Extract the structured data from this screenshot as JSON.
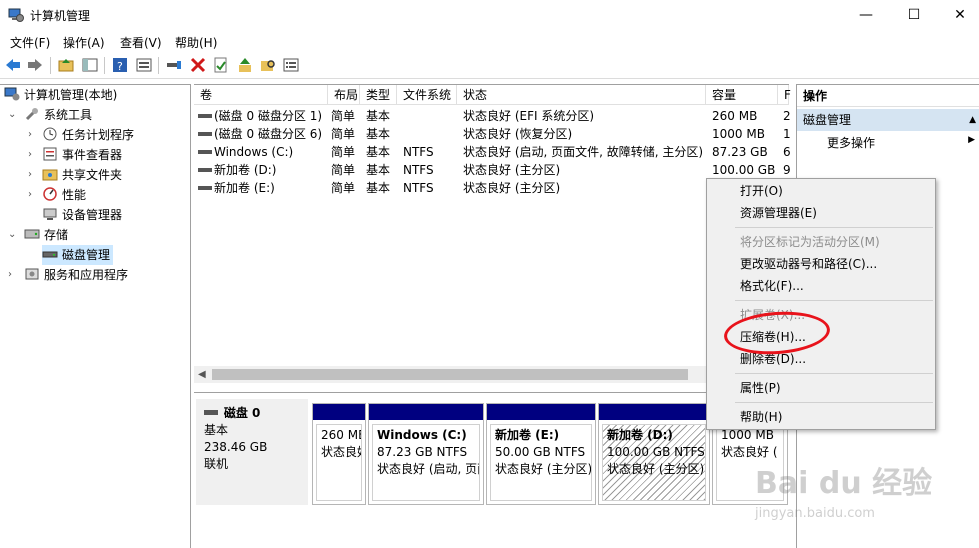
{
  "window": {
    "title": "计算机管理"
  },
  "menu": [
    "文件(F)",
    "操作(A)",
    "查看(V)",
    "帮助(H)"
  ],
  "tree": {
    "root": "计算机管理(本地)",
    "system_tools": "系统工具",
    "task_scheduler": "任务计划程序",
    "event_viewer": "事件查看器",
    "shared_folders": "共享文件夹",
    "performance": "性能",
    "device_manager": "设备管理器",
    "storage": "存储",
    "disk_management": "磁盘管理",
    "services": "服务和应用程序"
  },
  "columns": [
    "卷",
    "布局",
    "类型",
    "文件系统",
    "状态",
    "容量",
    "F"
  ],
  "volumes": [
    {
      "name": "(磁盘 0 磁盘分区 1)",
      "layout": "简单",
      "type": "基本",
      "fs": "",
      "status": "状态良好 (EFI 系统分区)",
      "capacity": "260 MB",
      "free": "2"
    },
    {
      "name": "(磁盘 0 磁盘分区 6)",
      "layout": "简单",
      "type": "基本",
      "fs": "",
      "status": "状态良好 (恢复分区)",
      "capacity": "1000 MB",
      "free": "1"
    },
    {
      "name": "Windows (C:)",
      "layout": "简单",
      "type": "基本",
      "fs": "NTFS",
      "status": "状态良好 (启动, 页面文件, 故障转储, 主分区)",
      "capacity": "87.23 GB",
      "free": "6"
    },
    {
      "name": "新加卷 (D:)",
      "layout": "简单",
      "type": "基本",
      "fs": "NTFS",
      "status": "状态良好 (主分区)",
      "capacity": "100.00 GB",
      "free": "9"
    },
    {
      "name": "新加卷 (E:)",
      "layout": "简单",
      "type": "基本",
      "fs": "NTFS",
      "status": "状态良好 (主分区)",
      "capacity": "",
      "free": ""
    }
  ],
  "disk": {
    "name": "磁盘 0",
    "type": "基本",
    "size": "238.46 GB",
    "state": "联机"
  },
  "partitions": [
    {
      "name": "",
      "line1": "260 MB",
      "line2": "状态良好"
    },
    {
      "name": "Windows  (C:)",
      "line1": "87.23 GB NTFS",
      "line2": "状态良好 (启动, 页面"
    },
    {
      "name": "新加卷  (E:)",
      "line1": "50.00 GB NTFS",
      "line2": "状态良好 (主分区)"
    },
    {
      "name": "新加卷  (D:)",
      "line1": "100.00 GB NTFS",
      "line2": "状态良好 (主分区)"
    },
    {
      "name": "",
      "line1": "1000 MB",
      "line2": "状态良好 ("
    }
  ],
  "actions": {
    "header": "操作",
    "section": "磁盘管理",
    "more": "更多操作"
  },
  "context_menu": {
    "open": "打开(O)",
    "explorer": "资源管理器(E)",
    "mark_active": "将分区标记为活动分区(M)",
    "change_letter": "更改驱动器号和路径(C)...",
    "format": "格式化(F)...",
    "extend": "扩展卷(X)...",
    "shrink": "压缩卷(H)...",
    "delete": "删除卷(D)...",
    "properties": "属性(P)",
    "help": "帮助(H)"
  },
  "watermark": {
    "logo": "Bai du 经验",
    "url": "jingyan.baidu.com"
  },
  "colors": {
    "partition_band": "#000080",
    "annotation": "#e8131b",
    "selection": "#cce8ff"
  }
}
